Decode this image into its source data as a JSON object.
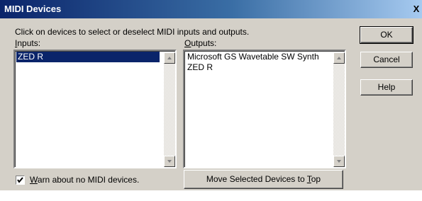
{
  "window": {
    "title": "MIDI Devices",
    "close_glyph": "X"
  },
  "instructions": "Click on devices to select or deselect MIDI inputs and outputs.",
  "inputs": {
    "label_accel": "I",
    "label_rest": "nputs:",
    "items": [
      {
        "label": "ZED R",
        "selected": true
      }
    ]
  },
  "outputs": {
    "label_accel": "O",
    "label_rest": "utputs:",
    "items": [
      {
        "label": "Microsoft GS Wavetable SW Synth",
        "selected": false
      },
      {
        "label": "ZED R",
        "selected": false
      }
    ]
  },
  "buttons": {
    "ok": "OK",
    "cancel": "Cancel",
    "help": "Help",
    "move_top_pre": "Move Selected Devices to ",
    "move_top_accel": "T",
    "move_top_post": "op"
  },
  "warn_checkbox": {
    "checked": true,
    "accel": "W",
    "label_rest": "arn about no MIDI devices."
  },
  "colors": {
    "title_bar": "#0a246a",
    "selection": "#0a246a",
    "face": "#d4d0c8"
  },
  "icons": {
    "scroll_up": "triangle-up",
    "scroll_down": "triangle-down",
    "check": "checkmark"
  }
}
